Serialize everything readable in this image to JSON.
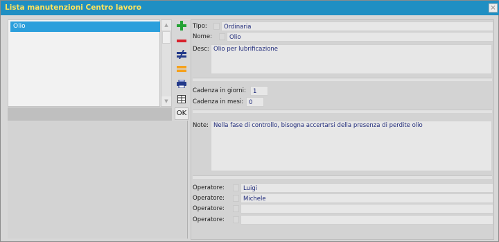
{
  "window": {
    "title": "Lista manutenzioni Centro lavoro",
    "close_glyph": "×"
  },
  "list": {
    "items": [
      {
        "label": "Olio"
      }
    ]
  },
  "toolbar": {
    "ok_label": "OK",
    "icons": [
      "add-icon",
      "remove-icon",
      "not-equal-icon",
      "equal-icon",
      "print-icon",
      "table-icon"
    ],
    "colors": {
      "add": "#25a336",
      "remove": "#d8222c",
      "neq": "#233a8a",
      "eq": "#f5a21e"
    }
  },
  "form": {
    "tipo_label": "Tipo:",
    "tipo_value": "Ordinaria",
    "nome_label": "Nome:",
    "nome_value": "Olio",
    "desc_label": "Desc:",
    "desc_value": "Olio per lubrificazione",
    "cadenza_giorni_label": "Cadenza in giorni:",
    "cadenza_giorni_value": "1",
    "cadenza_mesi_label": "Cadenza in mesi:",
    "cadenza_mesi_value": "0",
    "note_label": "Note:",
    "note_value": "Nella fase di controllo, bisogna accertarsi della presenza di perdite olio",
    "operatori": [
      {
        "label": "Operatore:",
        "value": "Luigi"
      },
      {
        "label": "Operatore:",
        "value": "Michele"
      },
      {
        "label": "Operatore:",
        "value": ""
      },
      {
        "label": "Operatore:",
        "value": ""
      }
    ]
  }
}
